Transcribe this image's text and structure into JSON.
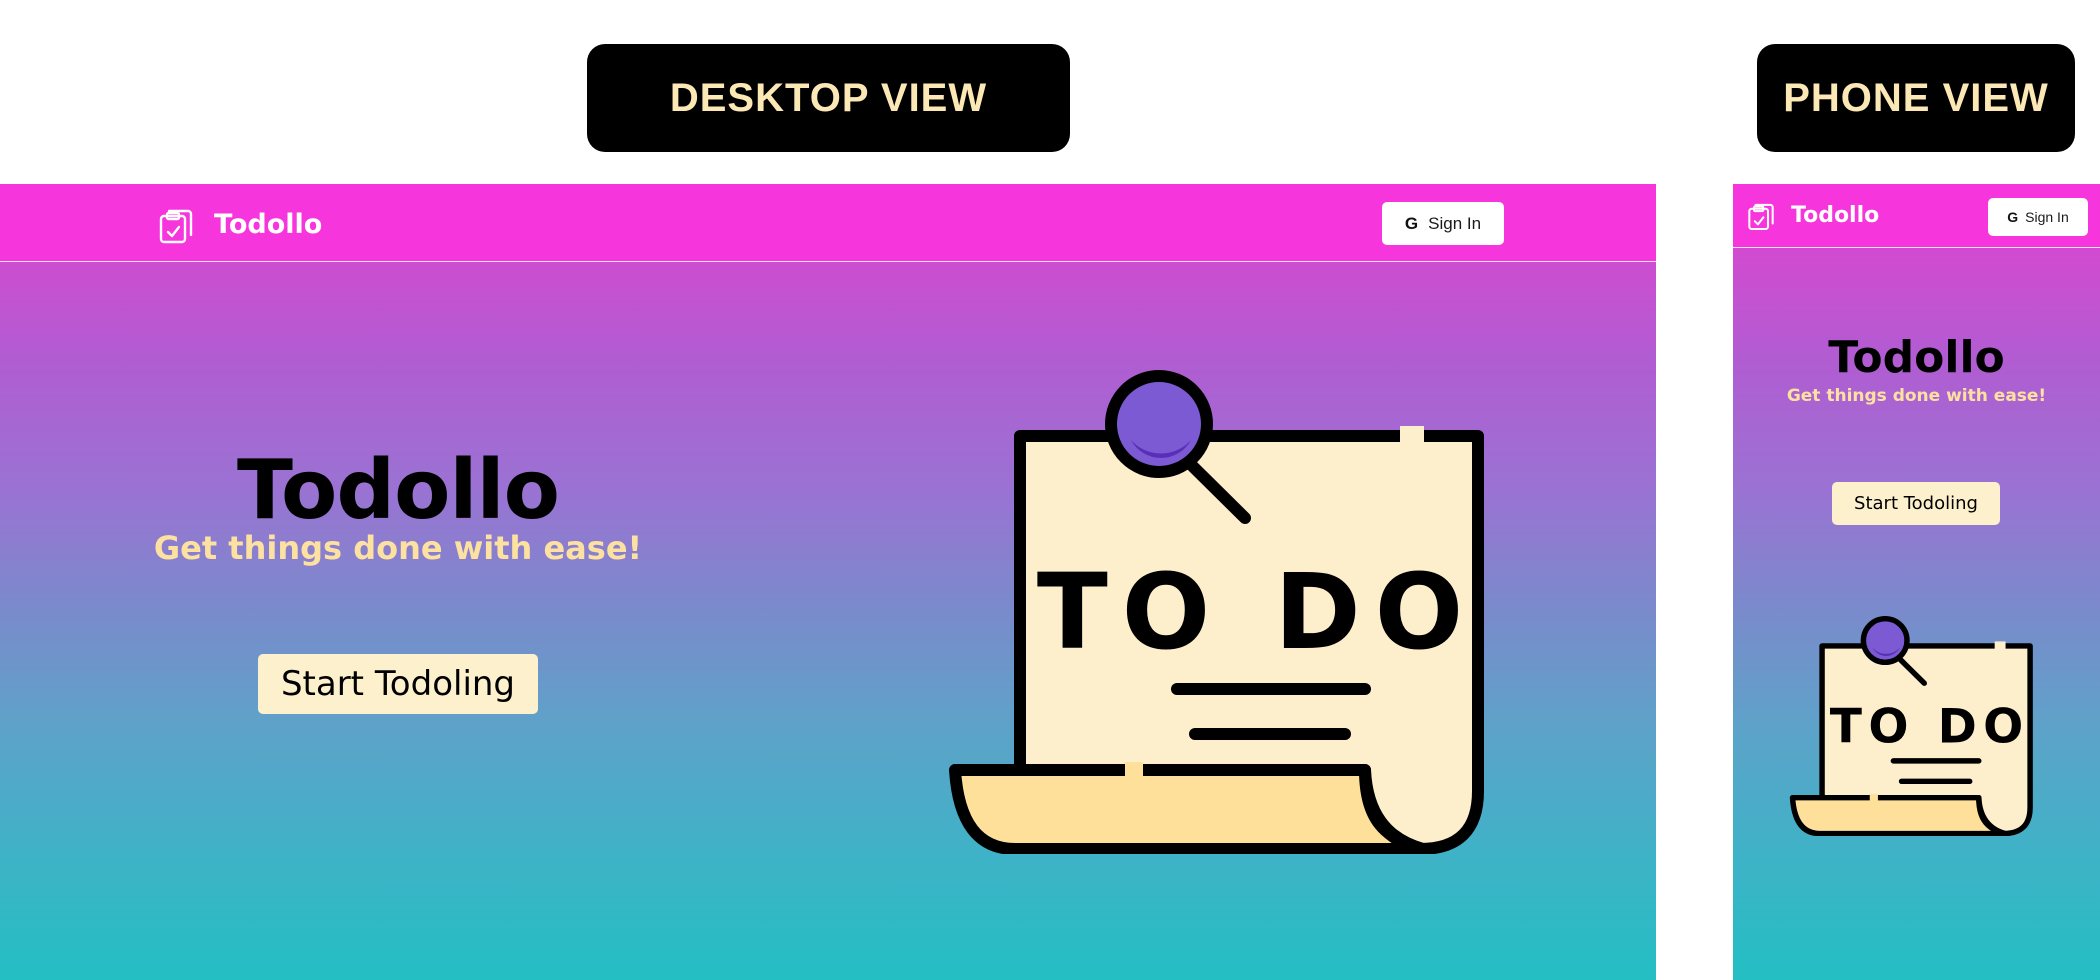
{
  "labels": {
    "desktop": "DESKTOP VIEW",
    "phone": "PHONE VIEW"
  },
  "app": {
    "brand_name": "Todollo",
    "brand_icon": "clipboard-check-icon",
    "signin_icon": "google-g-icon",
    "signin_glyph": "G",
    "signin_label": "Sign In",
    "hero_title": "Todollo",
    "hero_subtitle": "Get things done with ease!",
    "cta_label": "Start Todoling",
    "illustration": "todo-note-illustration",
    "illustration_text": "TO DO"
  },
  "colors": {
    "navbar": "#f735dc",
    "gradient_top": "#f535d8",
    "gradient_bottom": "#23bfc3",
    "subtitle": "#fde1a0",
    "cta_bg": "#fdf0cd",
    "label_bg": "#000000",
    "label_text": "#fbe8b5",
    "note_paper": "#fdefcc",
    "note_fold": "#fee09b",
    "pin": "#6b3ec9"
  }
}
